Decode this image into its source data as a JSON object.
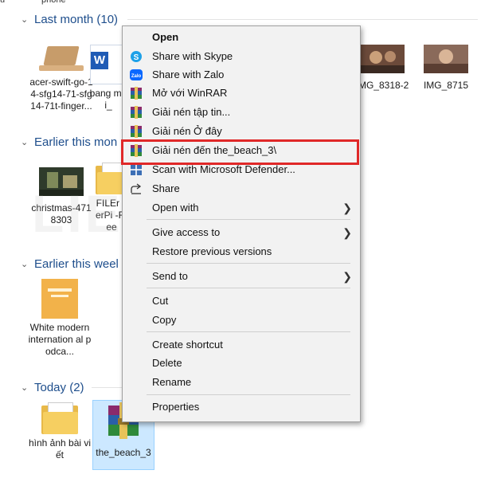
{
  "top_cut": [
    "u",
    "phone"
  ],
  "groups": [
    {
      "label": "Last month (10)"
    },
    {
      "label": "Earlier this mon"
    },
    {
      "label": "Earlier this weel"
    },
    {
      "label": "Today (2)"
    }
  ],
  "files_last_month": [
    {
      "label": "acer-swift-go-14-sfg14-71-sfg14-71t-finger..."
    },
    {
      "label": "bang moi_"
    },
    {
      "label": "IMG_8318-2"
    },
    {
      "label": "IMG_8715"
    }
  ],
  "files_earlier_month": [
    {
      "label": "christmas-4718303"
    },
    {
      "label": "FILEr zerPi -Free"
    }
  ],
  "files_earlier_week": [
    {
      "label": "White modern internation al podca..."
    }
  ],
  "files_today": [
    {
      "label": "hình ảnh bài viết"
    },
    {
      "label": "the_beach_3"
    }
  ],
  "icons": {
    "skype": "skype-icon",
    "zalo": "zalo-icon",
    "winrar": "winrar-icon",
    "defender": "defender-icon",
    "share": "share-icon"
  },
  "colors": {
    "highlight": "#e02828",
    "group_header": "#1e4e8c",
    "selected": "#cce8ff"
  },
  "menu": {
    "open": "Open",
    "share_skype": "Share with Skype",
    "share_zalo": "Share with Zalo",
    "open_winrar": "Mở với WinRAR",
    "extract_files": "Giải nén tập tin...",
    "extract_here": "Giải nén Ở đây",
    "extract_to": "Giải nén đến the_beach_3\\",
    "scan_defender": "Scan with Microsoft Defender...",
    "share": "Share",
    "open_with": "Open with",
    "give_access": "Give access to",
    "restore": "Restore previous versions",
    "send_to": "Send to",
    "cut": "Cut",
    "copy": "Copy",
    "create_shortcut": "Create shortcut",
    "delete": "Delete",
    "rename": "Rename",
    "properties": "Properties"
  },
  "watermark": {
    "main": "LIEN TRAN",
    "sub": "MOBILE"
  }
}
